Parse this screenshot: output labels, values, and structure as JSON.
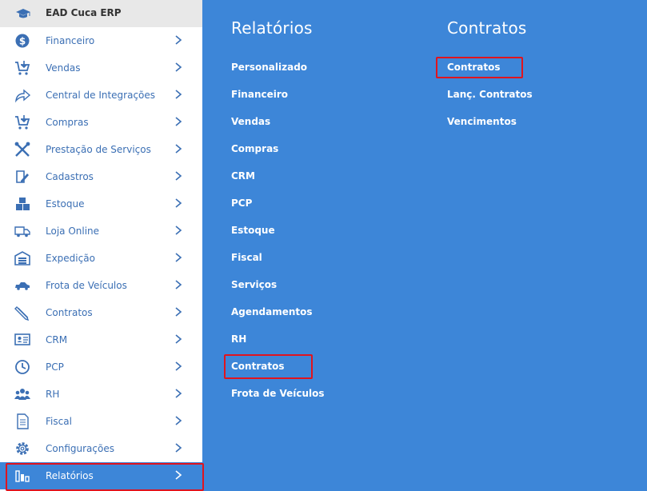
{
  "app": {
    "title": "EAD Cuca ERP"
  },
  "sidebar": {
    "items": [
      {
        "label": "Financeiro",
        "icon": "dollar-icon"
      },
      {
        "label": "Vendas",
        "icon": "cart-icon"
      },
      {
        "label": "Central de Integrações",
        "icon": "share-arrow-icon"
      },
      {
        "label": "Compras",
        "icon": "cart-icon"
      },
      {
        "label": "Prestação de Serviços",
        "icon": "tools-icon"
      },
      {
        "label": "Cadastros",
        "icon": "edit-icon"
      },
      {
        "label": "Estoque",
        "icon": "boxes-icon"
      },
      {
        "label": "Loja Online",
        "icon": "truck-icon"
      },
      {
        "label": "Expedição",
        "icon": "warehouse-icon"
      },
      {
        "label": "Frota de Veículos",
        "icon": "car-icon"
      },
      {
        "label": "Contratos",
        "icon": "pen-icon"
      },
      {
        "label": "CRM",
        "icon": "id-card-icon"
      },
      {
        "label": "PCP",
        "icon": "clock-icon"
      },
      {
        "label": "RH",
        "icon": "users-icon"
      },
      {
        "label": "Fiscal",
        "icon": "document-icon"
      },
      {
        "label": "Configurações",
        "icon": "gear-icon"
      },
      {
        "label": "Relatórios",
        "icon": "bar-chart-icon"
      }
    ]
  },
  "panel": {
    "relatorios": {
      "title": "Relatórios",
      "links": [
        "Personalizado",
        "Financeiro",
        "Vendas",
        "Compras",
        "CRM",
        "PCP",
        "Estoque",
        "Fiscal",
        "Serviços",
        "Agendamentos",
        "RH",
        "Contratos",
        "Frota de Veículos"
      ]
    },
    "contratos": {
      "title": "Contratos",
      "links": [
        "Contratos",
        "Lanç. Contratos",
        "Vencimentos"
      ]
    }
  },
  "colors": {
    "accent": "#3d86d8",
    "highlight": "#e0141e",
    "sidebar_text": "#3b6fb4"
  }
}
